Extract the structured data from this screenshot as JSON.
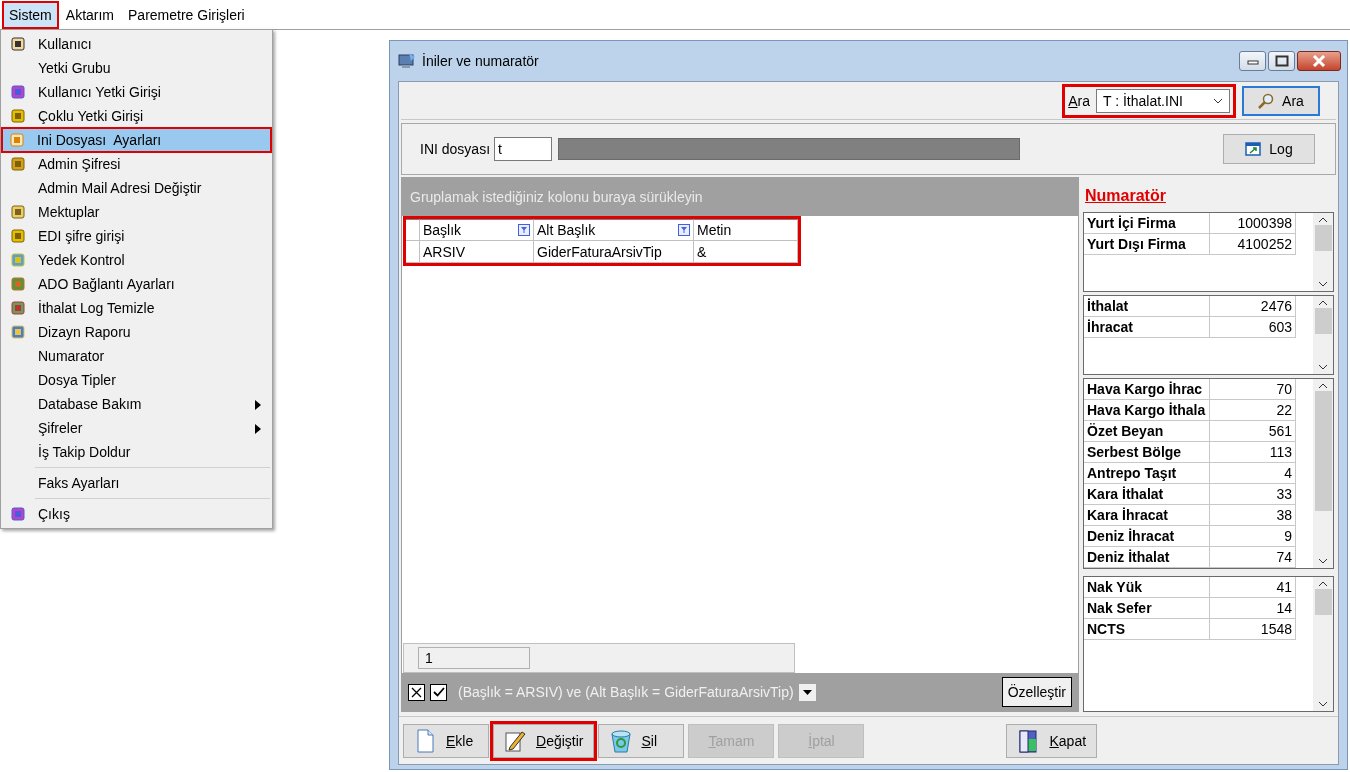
{
  "menubar": [
    {
      "label": "Sistem",
      "selected": true,
      "highlighted": true
    },
    {
      "label": "Aktarım",
      "selected": false,
      "highlighted": false
    },
    {
      "label": "Paremetre Girişleri",
      "selected": false,
      "highlighted": false
    }
  ],
  "menu": {
    "items": [
      {
        "kind": "item",
        "label": "Kullanıcı",
        "has_icon": true,
        "submenu": false,
        "selected": false,
        "highlighted": false
      },
      {
        "kind": "item",
        "label": "Yetki Grubu",
        "has_icon": false,
        "submenu": false,
        "selected": false,
        "highlighted": false
      },
      {
        "kind": "item",
        "label": "Kullanıcı Yetki Girişi",
        "has_icon": true,
        "submenu": false,
        "selected": false,
        "highlighted": false
      },
      {
        "kind": "item",
        "label": "Çoklu Yetki Girişi",
        "has_icon": true,
        "submenu": false,
        "selected": false,
        "highlighted": false
      },
      {
        "kind": "item",
        "label": "Ini Dosyası  Ayarları",
        "has_icon": true,
        "submenu": false,
        "selected": true,
        "highlighted": true
      },
      {
        "kind": "item",
        "label": "Admin Şifresi",
        "has_icon": true,
        "submenu": false,
        "selected": false,
        "highlighted": false
      },
      {
        "kind": "item",
        "label": "Admin Mail Adresi Değiştir",
        "has_icon": false,
        "submenu": false,
        "selected": false,
        "highlighted": false
      },
      {
        "kind": "item",
        "label": "Mektuplar",
        "has_icon": true,
        "submenu": false,
        "selected": false,
        "highlighted": false
      },
      {
        "kind": "item",
        "label": "EDI şifre girişi",
        "has_icon": true,
        "submenu": false,
        "selected": false,
        "highlighted": false
      },
      {
        "kind": "item",
        "label": "Yedek Kontrol",
        "has_icon": true,
        "submenu": false,
        "selected": false,
        "highlighted": false
      },
      {
        "kind": "item",
        "label": "ADO Bağlantı Ayarları",
        "has_icon": true,
        "submenu": false,
        "selected": false,
        "highlighted": false
      },
      {
        "kind": "item",
        "label": "İthalat Log Temizle",
        "has_icon": true,
        "submenu": false,
        "selected": false,
        "highlighted": false
      },
      {
        "kind": "item",
        "label": "Dizayn Raporu",
        "has_icon": true,
        "submenu": false,
        "selected": false,
        "highlighted": false
      },
      {
        "kind": "item",
        "label": "Numarator",
        "has_icon": false,
        "submenu": false,
        "selected": false,
        "highlighted": false
      },
      {
        "kind": "item",
        "label": "Dosya Tipler",
        "has_icon": false,
        "submenu": false,
        "selected": false,
        "highlighted": false
      },
      {
        "kind": "item",
        "label": "Database Bakım",
        "has_icon": false,
        "submenu": true,
        "selected": false,
        "highlighted": false
      },
      {
        "kind": "item",
        "label": "Şifreler",
        "has_icon": false,
        "submenu": true,
        "selected": false,
        "highlighted": false
      },
      {
        "kind": "item",
        "label": "İş Takip Doldur",
        "has_icon": false,
        "submenu": false,
        "selected": false,
        "highlighted": false
      },
      {
        "kind": "separator"
      },
      {
        "kind": "item",
        "label": "Faks Ayarları",
        "has_icon": false,
        "submenu": false,
        "selected": false,
        "highlighted": false
      },
      {
        "kind": "separator"
      },
      {
        "kind": "item",
        "label": "Çıkış",
        "has_icon": true,
        "submenu": false,
        "selected": false,
        "highlighted": false
      }
    ]
  },
  "window": {
    "title": "İniler ve numaratör",
    "search": {
      "label": "Ara",
      "value": "T : İthalat.INI",
      "button": "Ara",
      "highlighted": true
    },
    "ini_file": {
      "label": "INI dosyası",
      "value": "t",
      "log_button": "Log"
    },
    "grid": {
      "group_hint": "Gruplamak istediğiniz kolonu buraya sürükleyin",
      "highlighted": true,
      "columns": [
        {
          "label": "Başlık",
          "filter": true
        },
        {
          "label": "Alt Başlık",
          "filter": true
        },
        {
          "label": "Metin",
          "filter": false
        }
      ],
      "rows": [
        [
          "ARSIV",
          "GiderFaturaArsivTip",
          "&"
        ]
      ],
      "footer_count": "1",
      "filter": {
        "active": true,
        "text": "(Başlık = ARSIV) ve (Alt Başlık = GiderFaturaArsivTip)",
        "customize_button": "Özelleştir"
      }
    },
    "numerator": {
      "title": "Numaratör",
      "groups": [
        {
          "rows": [
            {
              "name": "Yurt İçi Firma",
              "value": "1000398"
            },
            {
              "name": "Yurt Dışı Firma",
              "value": "4100252"
            }
          ]
        },
        {
          "rows": [
            {
              "name": "İthalat",
              "value": "2476"
            },
            {
              "name": "İhracat",
              "value": "603"
            }
          ]
        },
        {
          "rows": [
            {
              "name": "Hava Kargo İhrac",
              "value": "70"
            },
            {
              "name": "Hava Kargo İthala",
              "value": "22"
            },
            {
              "name": "Özet Beyan",
              "value": "561"
            },
            {
              "name": "Serbest Bölge",
              "value": "113"
            },
            {
              "name": "Antrepo Taşıt",
              "value": "4"
            },
            {
              "name": "Kara İthalat",
              "value": "33"
            },
            {
              "name": "Kara İhracat",
              "value": "38"
            },
            {
              "name": "Deniz İhracat",
              "value": "9"
            },
            {
              "name": "Deniz İthalat",
              "value": "74"
            }
          ]
        },
        {
          "rows": [
            {
              "name": "Nak Yük",
              "value": "41"
            },
            {
              "name": "Nak Sefer",
              "value": "14"
            },
            {
              "name": "NCTS",
              "value": "1548"
            }
          ]
        }
      ]
    },
    "buttons": [
      {
        "label": "Ekle",
        "disabled": false,
        "highlighted": false
      },
      {
        "label": "Değiştir",
        "disabled": false,
        "highlighted": true
      },
      {
        "label": "Sil",
        "disabled": false,
        "highlighted": false
      },
      {
        "label": "Tamam",
        "disabled": true,
        "highlighted": false
      },
      {
        "label": "İptal",
        "disabled": true,
        "highlighted": false
      },
      {
        "label": "Kapat",
        "disabled": false,
        "highlighted": false
      }
    ]
  }
}
